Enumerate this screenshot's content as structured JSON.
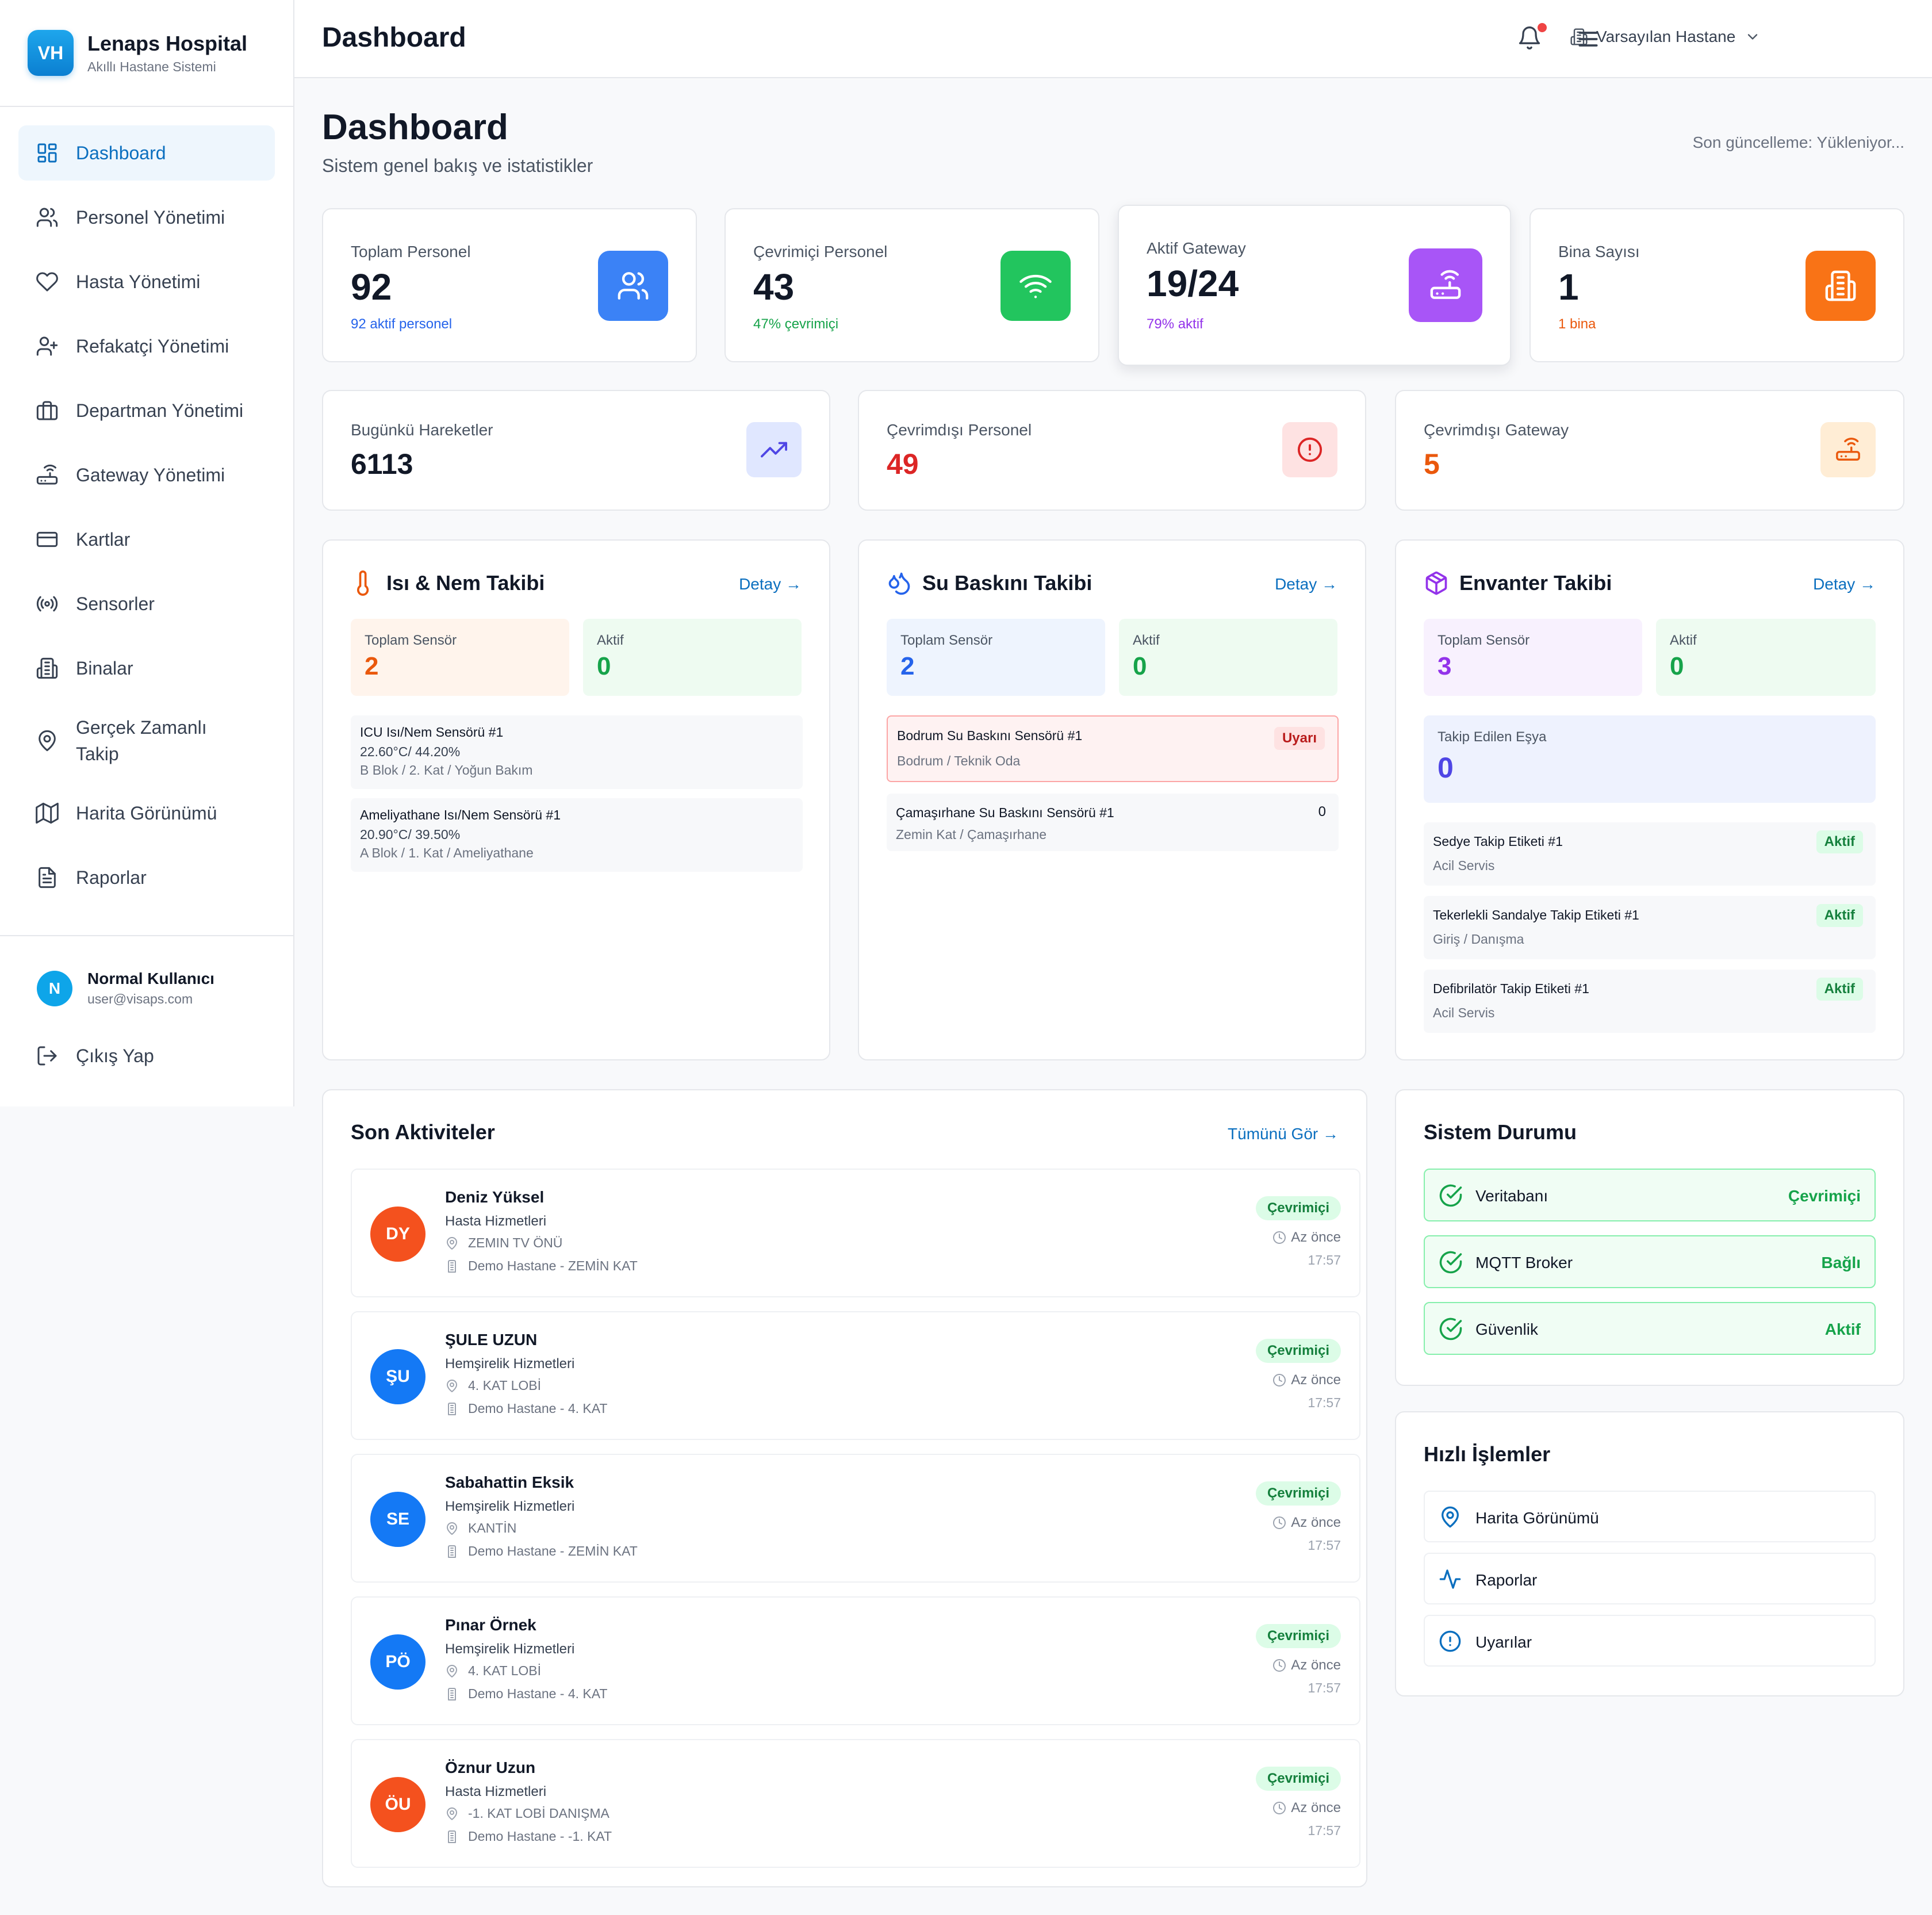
{
  "brand": {
    "logo_text": "VH",
    "title": "Lenaps Hospital",
    "subtitle": "Akıllı Hastane Sistemi"
  },
  "sidebar": {
    "items": [
      {
        "label": "Dashboard",
        "icon": "dashboard-grid-icon",
        "active": true
      },
      {
        "label": "Personel Yönetimi",
        "icon": "users-icon"
      },
      {
        "label": "Hasta Yönetimi",
        "icon": "heart-icon"
      },
      {
        "label": "Refakatçi Yönetimi",
        "icon": "user-plus-icon"
      },
      {
        "label": "Departman Yönetimi",
        "icon": "briefcase-icon"
      },
      {
        "label": "Gateway Yönetimi",
        "icon": "router-icon"
      },
      {
        "label": "Kartlar",
        "icon": "credit-card-icon"
      },
      {
        "label": "Sensorler",
        "icon": "radio-icon"
      },
      {
        "label": "Binalar",
        "icon": "building-icon"
      },
      {
        "label": "Gerçek Zamanlı Takip",
        "icon": "map-pin-icon"
      },
      {
        "label": "Harita Görünümü",
        "icon": "map-icon"
      },
      {
        "label": "Raporlar",
        "icon": "file-text-icon"
      }
    ],
    "user": {
      "initial": "N",
      "name": "Normal Kullanıcı",
      "email": "user@visaps.com"
    },
    "logout_label": "Çıkış Yap"
  },
  "topbar": {
    "title": "Dashboard",
    "hospital": "Varsayılan Hastane"
  },
  "page": {
    "title": "Dashboard",
    "subtitle": "Sistem genel bakış ve istatistikler",
    "last_update": "Son güncelleme: Yükleniyor..."
  },
  "stats": [
    {
      "label": "Toplam Personel",
      "value": "92",
      "sub": "92 aktif personel",
      "color": "#2563eb",
      "icon": "users-icon"
    },
    {
      "label": "Çevrimiçi Personel",
      "value": "43",
      "sub": "47% çevrimiçi",
      "color": "#16a34a",
      "icon": "wifi-icon"
    },
    {
      "label": "Aktif Gateway",
      "value": "19/24",
      "sub": "79% aktif",
      "color": "#9333ea",
      "icon": "router-icon"
    },
    {
      "label": "Bina Sayısı",
      "value": "1",
      "sub": "1 bina",
      "color": "#ea580c",
      "icon": "building-icon"
    }
  ],
  "stats2": [
    {
      "label": "Bugünkü Hareketler",
      "value": "6113",
      "color": "#111827",
      "icon": "trending-up-icon"
    },
    {
      "label": "Çevrimdışı Personel",
      "value": "49",
      "color": "#dc2626",
      "icon": "alert-circle-icon"
    },
    {
      "label": "Çevrimdışı Gateway",
      "value": "5",
      "color": "#ea580c",
      "icon": "router-icon"
    }
  ],
  "heat": {
    "title": "Isı & Nem Takibi",
    "detail": "Detay →",
    "total_label": "Toplam Sensör",
    "total": "2",
    "active_label": "Aktif",
    "active": "0",
    "sensors": [
      {
        "name": "ICU Isı/Nem Sensörü #1",
        "reading": "22.60°C/ 44.20%",
        "location": "B Blok / 2. Kat / Yoğun Bakım"
      },
      {
        "name": "Ameliyathane Isı/Nem Sensörü #1",
        "reading": "20.90°C/ 39.50%",
        "location": "A Blok / 1. Kat / Ameliyathane"
      }
    ]
  },
  "flood": {
    "title": "Su Baskını Takibi",
    "detail": "Detay →",
    "total_label": "Toplam Sensör",
    "total": "2",
    "active_label": "Aktif",
    "active": "0",
    "sensors": [
      {
        "name": "Bodrum Su Baskını Sensörü #1",
        "location": "Bodrum / Teknik Oda",
        "badge": "Uyarı"
      },
      {
        "name": "Çamaşırhane Su Baskını Sensörü #1",
        "location": "Zemin Kat / Çamaşırhane",
        "count": "0"
      }
    ]
  },
  "inventory": {
    "title": "Envanter Takibi",
    "detail": "Detay →",
    "total_label": "Toplam Sensör",
    "total": "3",
    "active_label": "Aktif",
    "active": "0",
    "tracked_label": "Takip Edilen Eşya",
    "tracked": "0",
    "items": [
      {
        "name": "Sedye Takip Etiketi #1",
        "location": "Acil Servis",
        "badge": "Aktif"
      },
      {
        "name": "Tekerlekli Sandalye Takip Etiketi #1",
        "location": "Giriş / Danışma",
        "badge": "Aktif"
      },
      {
        "name": "Defibrilatör Takip Etiketi #1",
        "location": "Acil Servis",
        "badge": "Aktif"
      }
    ]
  },
  "activities": {
    "title": "Son Aktiviteler",
    "see_all": "Tümünü Gör →",
    "items": [
      {
        "initials": "DY",
        "name": "Deniz Yüksel",
        "dept": "Hasta Hizmetleri",
        "location": "ZEMIN TV ÖNÜ",
        "hospital": "Demo Hastane - ZEMİN KAT",
        "status": "Çevrimiçi",
        "ago": "Az önce",
        "time": "17:57",
        "color": "#f4511e"
      },
      {
        "initials": "ŞU",
        "name": "ŞULE UZUN",
        "dept": "Hemşirelik Hizmetleri",
        "location": "4. KAT LOBİ",
        "hospital": "Demo Hastane - 4. KAT",
        "status": "Çevrimiçi",
        "ago": "Az önce",
        "time": "17:57",
        "color": "#1479f5"
      },
      {
        "initials": "SE",
        "name": "Sabahattin Eksik",
        "dept": "Hemşirelik Hizmetleri",
        "location": "KANTİN",
        "hospital": "Demo Hastane - ZEMİN KAT",
        "status": "Çevrimiçi",
        "ago": "Az önce",
        "time": "17:57",
        "color": "#1479f5"
      },
      {
        "initials": "PÖ",
        "name": "Pınar Örnek",
        "dept": "Hemşirelik Hizmetleri",
        "location": "4. KAT LOBİ",
        "hospital": "Demo Hastane - 4. KAT",
        "status": "Çevrimiçi",
        "ago": "Az önce",
        "time": "17:57",
        "color": "#1479f5"
      },
      {
        "initials": "ÖU",
        "name": "Öznur Uzun",
        "dept": "Hasta Hizmetleri",
        "location": "-1. KAT LOBİ DANIŞMA",
        "hospital": "Demo Hastane - -1. KAT",
        "status": "Çevrimiçi",
        "ago": "Az önce",
        "time": "17:57",
        "color": "#f4511e"
      }
    ]
  },
  "system": {
    "title": "Sistem Durumu",
    "items": [
      {
        "name": "Veritabanı",
        "value": "Çevrimiçi"
      },
      {
        "name": "MQTT Broker",
        "value": "Bağlı"
      },
      {
        "name": "Güvenlik",
        "value": "Aktif"
      }
    ]
  },
  "quick": {
    "title": "Hızlı İşlemler",
    "items": [
      {
        "label": "Harita Görünümü",
        "icon": "map-pin-icon"
      },
      {
        "label": "Raporlar",
        "icon": "activity-icon"
      },
      {
        "label": "Uyarılar",
        "icon": "alert-circle-icon"
      }
    ]
  }
}
